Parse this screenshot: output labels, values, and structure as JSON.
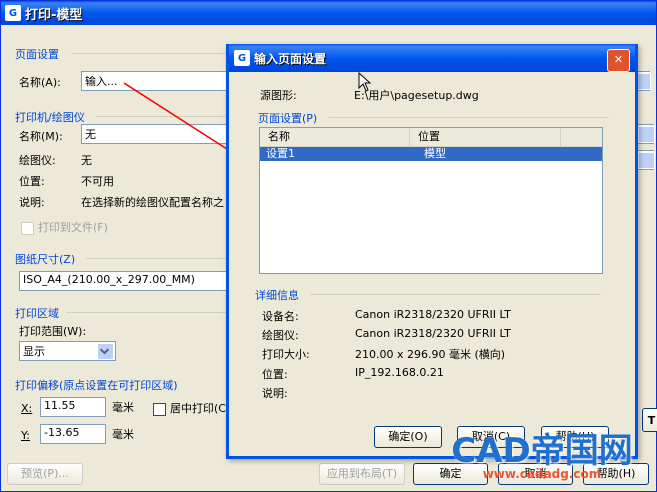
{
  "main": {
    "title": "打印-模型",
    "page_setup_label": "页面设置",
    "name_label": "名称(A):",
    "name_value": "输入...",
    "printer_label": "打印机/绘图仪",
    "printer_name_label": "名称(M):",
    "printer_name_value": "无",
    "plotter_label": "绘图仪:",
    "plotter_value": "无",
    "location_label": "位置:",
    "location_value": "不可用",
    "desc_label": "说明:",
    "desc_value": "在选择新的绘图仪配置名称之",
    "plot_to_file": "打印到文件(F)",
    "paper_size_label": "图纸尺寸(Z)",
    "paper_size_value": "ISO_A4_(210.00_x_297.00_MM)",
    "plot_area_label": "打印区域",
    "plot_range_label": "打印范围(W):",
    "plot_range_value": "显示",
    "plot_offset_label": "打印偏移(原点设置在可打印区域)",
    "x_label": "X:",
    "x_value": "11.55",
    "y_label": "Y:",
    "y_value": "-13.65",
    "unit_mm": "毫米",
    "center_plot": "居中打印(C)",
    "preview_btn": "预览(P)...",
    "apply_layout_btn": "应用到布局(T)",
    "ok_btn": "确定",
    "cancel_btn": "取消",
    "help_btn": "帮助(H)"
  },
  "dialog": {
    "title": "输入页面设置",
    "source_label": "源图形:",
    "source_value": "E:\\用户\\pagesetup.dwg",
    "page_setups_label": "页面设置(P)",
    "col_name": "名称",
    "col_location": "位置",
    "rows": [
      {
        "name": "设置1",
        "location": "模型"
      }
    ],
    "details_label": "详细信息",
    "device_label": "设备名:",
    "device_value": "Canon iR2318/2320 UFRII LT",
    "plotter_label": "绘图仪:",
    "plotter_value": "Canon iR2318/2320 UFRII LT",
    "plot_size_label": "打印大小:",
    "plot_size_value": "210.00 x 296.90 毫米 (横向)",
    "where_label": "位置:",
    "where_value": "IP_192.168.0.21",
    "desc_label": "说明:",
    "ok_btn": "确定(O)",
    "cancel_btn": "取消(C)",
    "help_btn": "帮助(H)"
  },
  "watermark": {
    "text": "CAD帝国网",
    "url": "www.cadadg.com"
  }
}
